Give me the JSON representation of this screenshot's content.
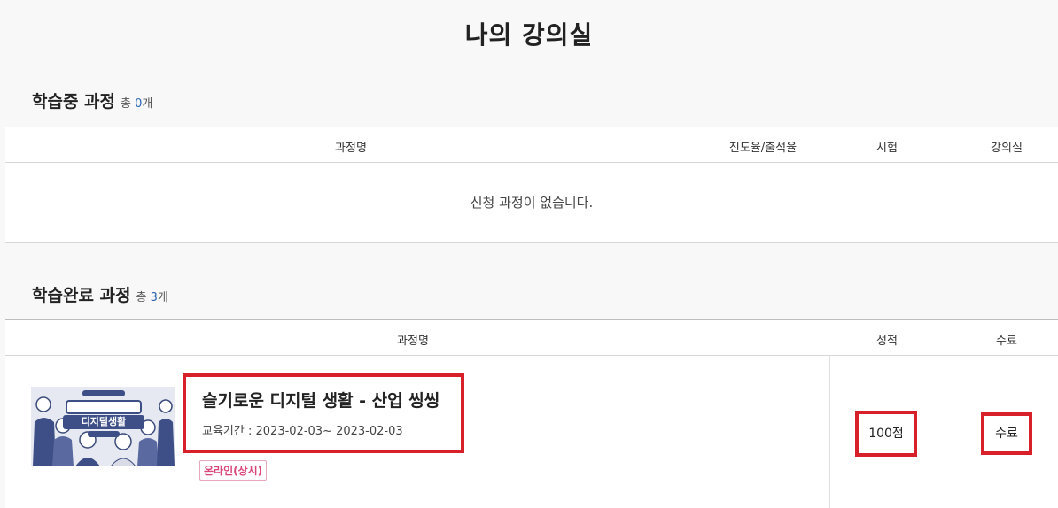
{
  "page": {
    "title": "나의 강의실"
  },
  "in_progress": {
    "title": "학습중 과정",
    "count_prefix": "총",
    "count_value": "0",
    "count_suffix": "개",
    "columns": {
      "course": "과정명",
      "progress": "진도율/출석율",
      "exam": "시험",
      "classroom": "강의실"
    },
    "empty_message": "신청 과정이 없습니다."
  },
  "completed": {
    "title": "학습완료 과정",
    "count_prefix": "총",
    "count_value": "3",
    "count_suffix": "개",
    "columns": {
      "course": "과정명",
      "grade": "성적",
      "completion": "수료"
    },
    "rows": [
      {
        "thumbnail_text": "디지털생활",
        "name": "슬기로운 디지털 생활 - 산업 씽씽",
        "period_label": "교육기간 : ",
        "period": "2023-02-03~ 2023-02-03",
        "tag": "온라인(상시)",
        "grade": "100점",
        "completion": "수료"
      }
    ]
  }
}
